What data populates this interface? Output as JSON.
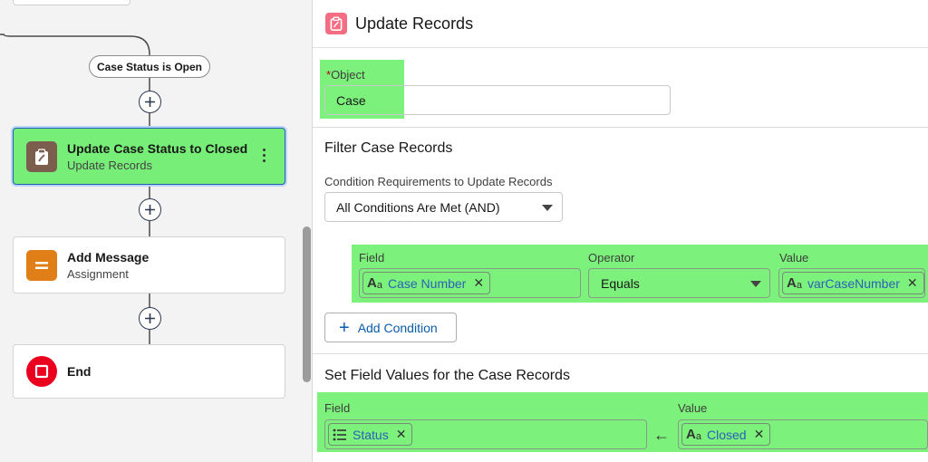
{
  "canvas": {
    "decision_label": "Case Status is Open",
    "nodes": [
      {
        "title": "Update Case Status to Closed",
        "subtitle": "Update Records",
        "icon": "clipboard-icon",
        "color": "#7b5e4e",
        "selected": true
      },
      {
        "title": "Add Message",
        "subtitle": "Assignment",
        "icon": "equals-icon",
        "color": "#e07e17"
      },
      {
        "title": "End",
        "subtitle": "",
        "icon": "stop-icon",
        "color": "#ea001e"
      }
    ]
  },
  "panel": {
    "title": "Update Records",
    "header_icon": "clipboard-icon",
    "header_icon_color": "#f36e83",
    "object": {
      "required_mark": "*",
      "label": "Object",
      "value": "Case"
    },
    "filter": {
      "section_title": "Filter Case Records",
      "condition_label": "Condition Requirements to Update Records",
      "condition_value": "All Conditions Are Met (AND)",
      "headers": {
        "field": "Field",
        "operator": "Operator",
        "value": "Value"
      },
      "row": {
        "field": "Case Number",
        "operator": "Equals",
        "value": "varCaseNumber"
      },
      "add_condition_label": "Add Condition"
    },
    "set_values": {
      "section_title": "Set Field Values for the Case Records",
      "headers": {
        "field": "Field",
        "value": "Value"
      },
      "row": {
        "field": "Status",
        "value": "Closed"
      }
    }
  },
  "colors": {
    "highlight": "#7cf17c",
    "link": "#2a62b8",
    "selected_border": "#1f5fb8"
  }
}
